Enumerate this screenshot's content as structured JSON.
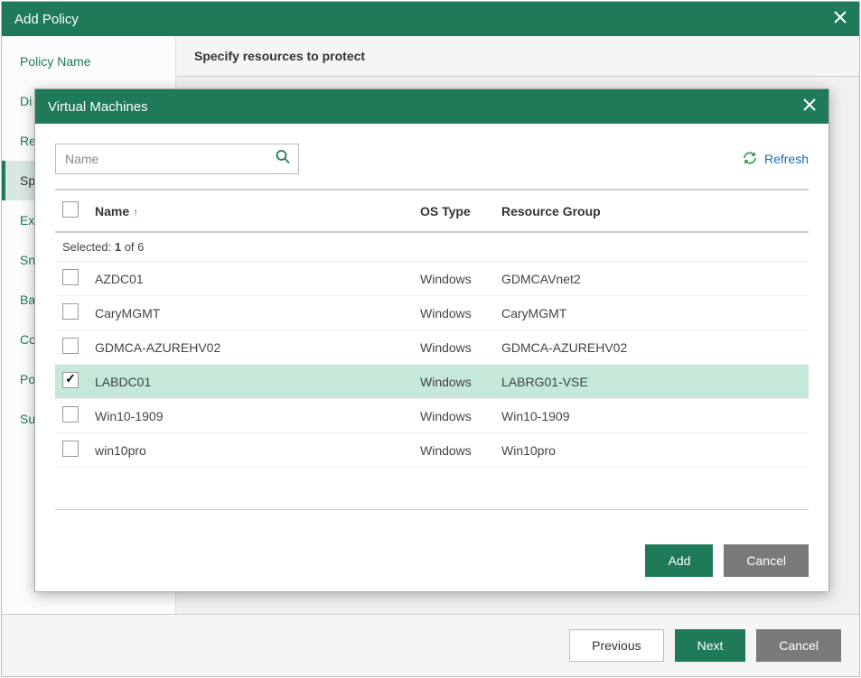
{
  "outer": {
    "title": "Add Policy",
    "main_header": "Specify resources to protect"
  },
  "sidebar": {
    "items": [
      {
        "label": "Policy Name",
        "active": false
      },
      {
        "label": "Di",
        "active": false
      },
      {
        "label": "Re",
        "active": false
      },
      {
        "label": "Sp",
        "active": true
      },
      {
        "label": "Ex",
        "active": false
      },
      {
        "label": "Sn",
        "active": false
      },
      {
        "label": "Ba",
        "active": false
      },
      {
        "label": "Co",
        "active": false
      },
      {
        "label": "Po",
        "active": false
      },
      {
        "label": "Su",
        "active": false
      }
    ]
  },
  "outer_footer": {
    "previous": "Previous",
    "next": "Next",
    "cancel": "Cancel"
  },
  "modal": {
    "title": "Virtual Machines",
    "search_placeholder": "Name",
    "refresh_label": "Refresh",
    "selected_label": "Selected:",
    "selected_count": "1",
    "selected_total": "of 6",
    "columns": {
      "name": "Name",
      "os": "OS Type",
      "rg": "Resource Group"
    },
    "rows": [
      {
        "name": "AZDC01",
        "os": "Windows",
        "rg": "GDMCAVnet2",
        "checked": false
      },
      {
        "name": "CaryMGMT",
        "os": "Windows",
        "rg": "CaryMGMT",
        "checked": false
      },
      {
        "name": "GDMCA-AZUREHV02",
        "os": "Windows",
        "rg": "GDMCA-AZUREHV02",
        "checked": false
      },
      {
        "name": "LABDC01",
        "os": "Windows",
        "rg": "LABRG01-VSE",
        "checked": true
      },
      {
        "name": "Win10-1909",
        "os": "Windows",
        "rg": "Win10-1909",
        "checked": false
      },
      {
        "name": "win10pro",
        "os": "Windows",
        "rg": "Win10pro",
        "checked": false
      }
    ],
    "footer": {
      "add": "Add",
      "cancel": "Cancel"
    }
  }
}
